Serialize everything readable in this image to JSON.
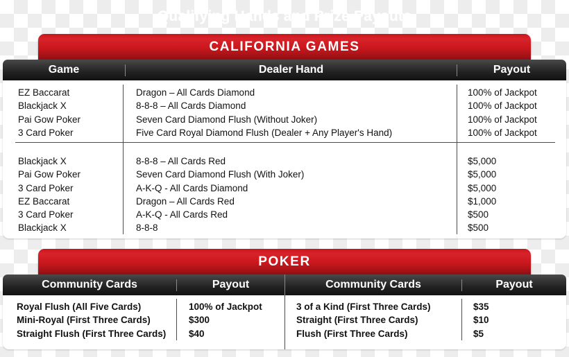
{
  "document": {
    "title": "Qualifying Hands and Prize Payouts"
  },
  "colors": {
    "banner_red": "#c8171d",
    "header_black": "#222222",
    "text": "#111111",
    "rule": "#4b4b4b"
  },
  "california": {
    "banner_label": "CALIFORNIA GAMES",
    "columns": [
      "Game",
      "Dealer Hand",
      "Payout"
    ],
    "group1": {
      "game": [
        "EZ Baccarat",
        "Blackjack X",
        "Pai Gow Poker",
        "3 Card Poker"
      ],
      "dealer_hand": [
        "Dragon – All Cards Diamond",
        "8-8-8 – All Cards Diamond",
        "Seven Card Diamond Flush (Without Joker)",
        "Five Card Royal Diamond Flush (Dealer + Any Player's Hand)"
      ],
      "payout": [
        "100% of Jackpot",
        "100% of Jackpot",
        "100% of Jackpot",
        "100% of Jackpot"
      ]
    },
    "group2": {
      "game": [
        "Blackjack X",
        "Pai Gow Poker",
        "3 Card Poker",
        "EZ Baccarat",
        "3 Card Poker",
        "Blackjack X"
      ],
      "dealer_hand": [
        "8-8-8 – All Cards Red",
        "Seven Card Diamond Flush (With Joker)",
        "A-K-Q - All Cards Diamond",
        "Dragon – All Cards Red",
        "A-K-Q - All Cards Red",
        "8-8-8"
      ],
      "payout": [
        "$5,000",
        "$5,000",
        "$5,000",
        "$1,000",
        "$500",
        "$500"
      ]
    }
  },
  "poker": {
    "banner_label": "POKER",
    "columns": [
      "Community Cards",
      "Payout",
      "Community Cards",
      "Payout"
    ],
    "left": {
      "community_cards": [
        "Royal Flush (All Five Cards)",
        "Mini-Royal (First Three Cards)",
        "Straight Flush (First Three Cards)"
      ],
      "payout": [
        "100% of Jackpot",
        "$300",
        "$40"
      ]
    },
    "right": {
      "community_cards": [
        "3 of a Kind (First Three Cards)",
        "Straight (First Three Cards)",
        "Flush (First Three Cards)"
      ],
      "payout": [
        "$35",
        "$10",
        "$5"
      ]
    }
  }
}
